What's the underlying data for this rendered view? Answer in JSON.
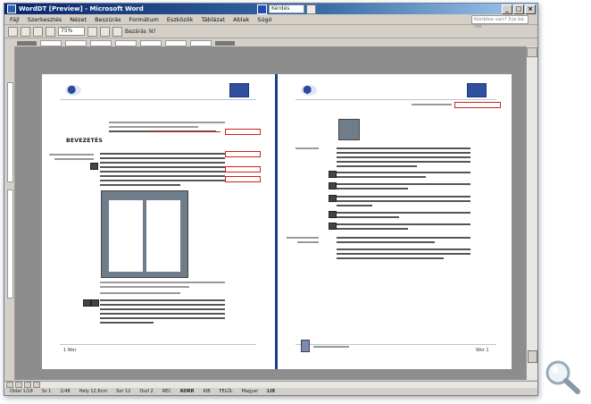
{
  "window": {
    "title": "WordDT [Preview] - Microsoft Word",
    "search_placeholder": "Kérdés",
    "controls": [
      "_",
      "□",
      "×"
    ]
  },
  "menu": {
    "items": [
      "Fájl",
      "Szerkesztés",
      "Nézet",
      "Beszúrás",
      "Formátum",
      "Eszközök",
      "Táblázat",
      "Ablak",
      "Súgó"
    ],
    "help_placeholder": "Kérdése van? Írja be ide"
  },
  "toolbar": {
    "zoom_value": "75%",
    "close_label": "Bezárás",
    "help_label": "N?"
  },
  "document": {
    "left_page": {
      "heading": "BEVEZETÉS",
      "page_number": "1 Wor"
    },
    "right_page": {
      "page_number": "Wor 1"
    }
  },
  "status": {
    "items": [
      "Oldal 1/18",
      "Sz 1",
      "1/48",
      "Hely 12,6cm",
      "Sor 12",
      "Oszl 2",
      "REC",
      "KORR",
      "KIB",
      "FELÜL",
      "Magyar",
      "LIX"
    ]
  },
  "colors": {
    "title_start": "#0a246a",
    "spine": "#1b3f8a",
    "revision_marks": "#d02020"
  },
  "icons": [
    "word-icon",
    "zoom-magnifier-icon",
    "print-icon",
    "save-icon"
  ]
}
